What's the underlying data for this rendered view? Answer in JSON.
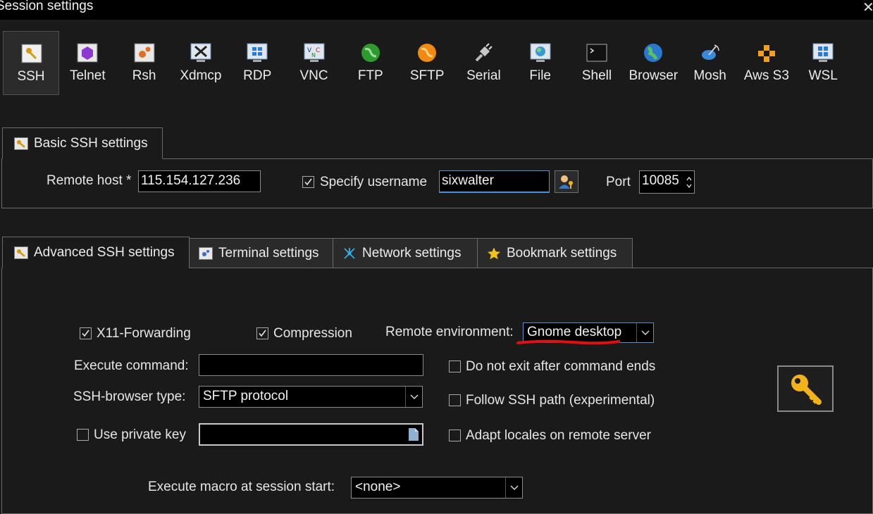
{
  "window": {
    "title": "Session settings",
    "close_glyph": "✕"
  },
  "session_types": [
    {
      "label": "SSH",
      "icon": "key-icon",
      "active": true
    },
    {
      "label": "Telnet",
      "icon": "telnet-icon"
    },
    {
      "label": "Rsh",
      "icon": "rsh-icon"
    },
    {
      "label": "Xdmcp",
      "icon": "xdmcp-icon"
    },
    {
      "label": "RDP",
      "icon": "rdp-icon"
    },
    {
      "label": "VNC",
      "icon": "vnc-icon"
    },
    {
      "label": "FTP",
      "icon": "ftp-globe-icon"
    },
    {
      "label": "SFTP",
      "icon": "sftp-globe-icon"
    },
    {
      "label": "Serial",
      "icon": "serial-plug-icon"
    },
    {
      "label": "File",
      "icon": "file-monitor-icon"
    },
    {
      "label": "Shell",
      "icon": "shell-icon"
    },
    {
      "label": "Browser",
      "icon": "browser-globe-icon"
    },
    {
      "label": "Mosh",
      "icon": "mosh-satellite-icon"
    },
    {
      "label": "Aws S3",
      "icon": "aws-s3-icon"
    },
    {
      "label": "WSL",
      "icon": "wsl-icon"
    }
  ],
  "basic": {
    "tab_label": "Basic SSH settings",
    "remote_host_label": "Remote host *",
    "remote_host_value": "115.154.127.236",
    "specify_username_label": "Specify username",
    "specify_username_checked": true,
    "username_value": "sixwalter",
    "port_label": "Port",
    "port_value": "10085"
  },
  "tabs": [
    {
      "label": "Advanced SSH settings",
      "icon": "key-icon",
      "active": true
    },
    {
      "label": "Terminal settings",
      "icon": "terminal-icon"
    },
    {
      "label": "Network settings",
      "icon": "network-icon"
    },
    {
      "label": "Bookmark settings",
      "icon": "star-icon"
    }
  ],
  "advanced": {
    "x11_label": "X11-Forwarding",
    "x11_checked": true,
    "compression_label": "Compression",
    "compression_checked": true,
    "remote_env_label": "Remote environment:",
    "remote_env_value": "Gnome desktop",
    "execute_command_label": "Execute command:",
    "execute_command_value": "",
    "ssh_browser_label": "SSH-browser type:",
    "ssh_browser_value": "SFTP protocol",
    "private_key_label": "Use private key",
    "private_key_checked": false,
    "private_key_value": "",
    "no_exit_label": "Do not exit after command ends",
    "follow_path_label": "Follow SSH path (experimental)",
    "adapt_locales_label": "Adapt locales on remote server",
    "macro_label": "Execute macro at session start:",
    "macro_value": "<none>"
  },
  "colors": {
    "annotation_underline": "#e01010",
    "key_gold": "#f2b21a",
    "focus_border": "#4a8ee0"
  }
}
